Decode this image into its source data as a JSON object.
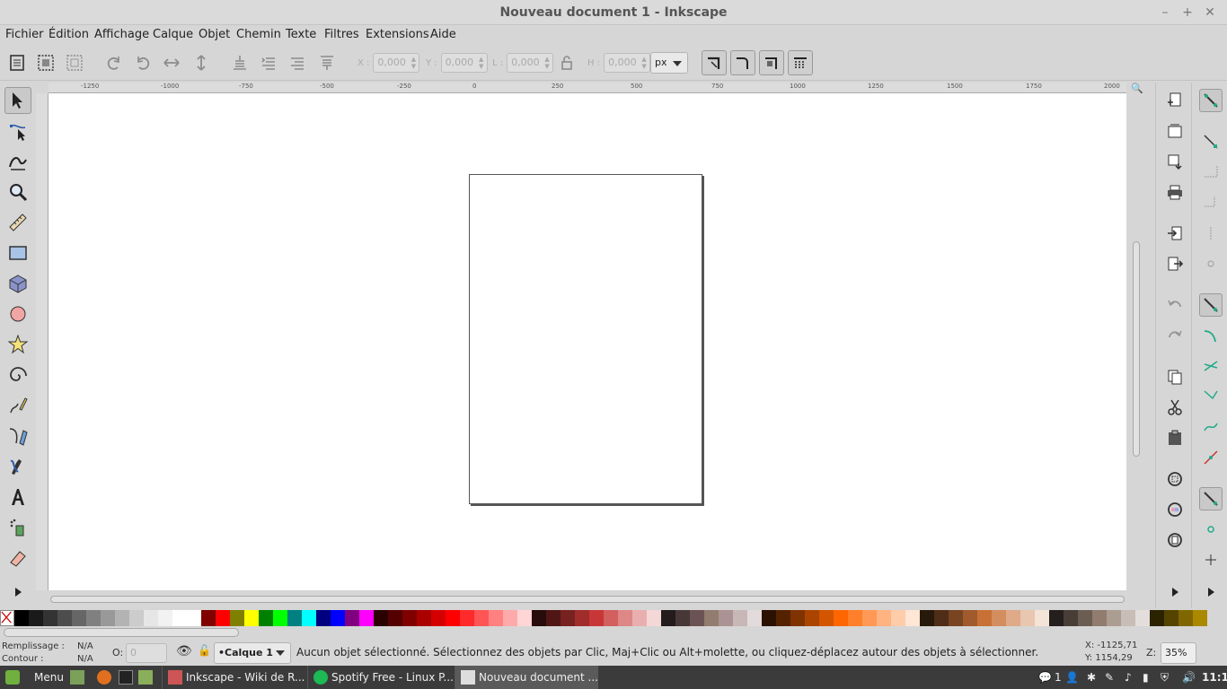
{
  "window": {
    "title": "Nouveau document 1 - Inkscape",
    "min": "–",
    "max": "+",
    "close": "✕"
  },
  "menu": [
    "Fichier",
    "Édition",
    "Affichage",
    "Calque",
    "Objet",
    "Chemin",
    "Texte",
    "Filtres",
    "Extensions",
    "Aide"
  ],
  "transform": {
    "x_label": "X :",
    "x_value": "0,000",
    "y_label": "Y :",
    "y_value": "0,000",
    "w_label": "L :",
    "w_value": "0,000",
    "h_label": "H :",
    "h_value": "0,000",
    "unit": "px"
  },
  "ruler": {
    "h_ticks": [
      "-1250",
      "-1000",
      "-750",
      "-500",
      "-250",
      "0",
      "250",
      "500",
      "750",
      "1000",
      "1250",
      "1500",
      "1750",
      "2000"
    ]
  },
  "status": {
    "fill_label": "Remplissage :",
    "fill_value": "N/A",
    "stroke_label": "Contour :",
    "stroke_value": "N/A",
    "opacity_label": "O:",
    "opacity_value": "0",
    "layer": "•Calque 1",
    "message": "Aucun objet sélectionné. Sélectionnez des objets par Clic, Maj+Clic ou Alt+molette, ou cliquez-déplacez autour des objets à sélectionner.",
    "x_coord": "X: -1125,71",
    "y_coord": "Y:   1154,29",
    "zoom_label": "Z:",
    "zoom": "35%"
  },
  "taskbar": {
    "menu": "Menu",
    "win1": "Inkscape - Wiki de R...",
    "win2": "Spotify Free - Linux P...",
    "win3": "Nouveau document ...",
    "notif": "1",
    "time": "11:11"
  },
  "palette": [
    "#000000",
    "#1a1a1a",
    "#333333",
    "#4d4d4d",
    "#666666",
    "#808080",
    "#999999",
    "#b3b3b3",
    "#cccccc",
    "#e6e6e6",
    "#f2f2f2",
    "#ffffff",
    "#ffffff",
    "#800000",
    "#ff0000",
    "#808000",
    "#ffff00",
    "#008000",
    "#00ff00",
    "#008080",
    "#00ffff",
    "#000080",
    "#0000ff",
    "#800080",
    "#ff00ff",
    "#2b0000",
    "#550000",
    "#800000",
    "#aa0000",
    "#d40000",
    "#ff0000",
    "#ff2a2a",
    "#ff5555",
    "#ff8080",
    "#ffaaaa",
    "#ffd5d5",
    "#280b0b",
    "#501616",
    "#782121",
    "#a02c2c",
    "#c83737",
    "#d35f5f",
    "#de8787",
    "#e9afaf",
    "#f4d7d7",
    "#241c1c",
    "#483737",
    "#6c5353",
    "#917c6f",
    "#ac9393",
    "#c8b7b7",
    "#e3dbdb",
    "#2b1100",
    "#552200",
    "#803300",
    "#aa4400",
    "#d45500",
    "#ff6600",
    "#ff7f2a",
    "#ff9955",
    "#ffb380",
    "#ffccaa",
    "#ffe6d5",
    "#281a0b",
    "#502d16",
    "#784421",
    "#a05a2c",
    "#c87137",
    "#d38d5f",
    "#deaa87",
    "#e9c6af",
    "#f4e3d7",
    "#241f1c",
    "#483e37",
    "#6c5d53",
    "#917c6f",
    "#ac9d93",
    "#c8beb7",
    "#e3dedb",
    "#2b2200",
    "#554400",
    "#806600",
    "#aa8800"
  ]
}
